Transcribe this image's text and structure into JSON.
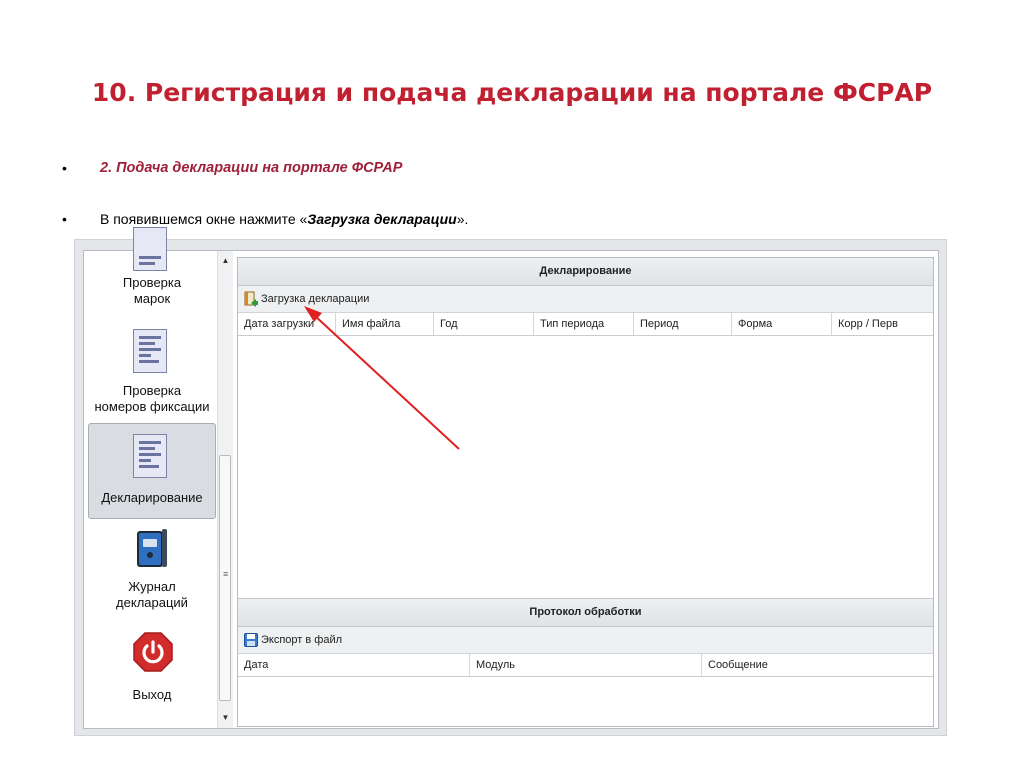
{
  "slide": {
    "title": "10. Регистрация и подача декларации на портале ФСРАР",
    "bullet_marker": "•",
    "subtitle": "2.  Подача декларации на портале ФСРАР",
    "instruction_prefix": "В появившемся окне нажмите «",
    "instruction_bold": "Загрузка декларации",
    "instruction_suffix": "»."
  },
  "nav": {
    "items": [
      {
        "label_line1": "Проверка",
        "label_line2": "марок",
        "icon": "document-icon"
      },
      {
        "label_line1": "Проверка",
        "label_line2": "номеров фиксации",
        "icon": "document-icon"
      },
      {
        "label_line1": "Декларирование",
        "icon": "document-icon",
        "active": true
      },
      {
        "label_line1": "Журнал",
        "label_line2": "деклараций",
        "icon": "binder-icon"
      },
      {
        "label_line1": "Выход",
        "icon": "power-icon"
      }
    ],
    "scroll_up": "▲",
    "scroll_down": "▼",
    "grip": "≡"
  },
  "declarations_panel": {
    "title": "Декларирование",
    "toolbar": {
      "upload_label": "Загрузка декларации",
      "icon": "upload-icon"
    },
    "columns": [
      "Дата загрузки",
      "Имя файла",
      "Год",
      "Тип периода",
      "Период",
      "Форма",
      "Корр / Перв"
    ],
    "rows": []
  },
  "protocol_panel": {
    "title": "Протокол обработки",
    "toolbar": {
      "export_label": "Экспорт в файл",
      "icon": "save-icon"
    },
    "columns": [
      "Дата",
      "Модуль",
      "Сообщение"
    ],
    "rows": []
  },
  "colors": {
    "title_red": "#c0202f",
    "subtitle_red": "#a0203a",
    "arrow_red": "#e02020",
    "panel_header": "#dfe2e6",
    "active_nav": "#d9dce0"
  }
}
